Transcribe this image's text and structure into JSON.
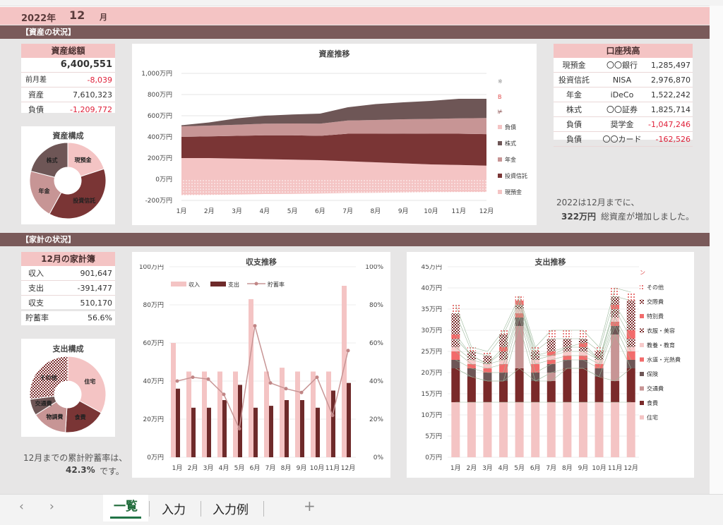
{
  "header": {
    "year": "2022年",
    "month": "12",
    "month_unit": "月"
  },
  "sections": {
    "assets": "【資産の状況】",
    "household": "【家計の状況】"
  },
  "asset_total": {
    "title": "資産総額",
    "total": "6,400,551",
    "rows": [
      {
        "label": "前月差",
        "value": "-8,039",
        "neg": true
      },
      {
        "label": "資産",
        "value": "7,610,323",
        "neg": false
      },
      {
        "label": "負債",
        "value": "-1,209,772",
        "neg": true
      }
    ]
  },
  "asset_pie": {
    "title": "資産構成",
    "labels": [
      "現預金",
      "投資信託",
      "年金",
      "株式"
    ],
    "values": [
      20,
      38,
      21,
      21
    ],
    "colors": [
      "#f4c4c4",
      "#7a3535",
      "#c79595",
      "#6e5656"
    ]
  },
  "balance": {
    "title": "口座残高",
    "rows": [
      {
        "cat": "現預金",
        "name": "〇〇銀行",
        "value": "1,285,497",
        "neg": false
      },
      {
        "cat": "投資信託",
        "name": "NISA",
        "value": "2,976,870",
        "neg": false
      },
      {
        "cat": "年金",
        "name": "iDeCo",
        "value": "1,522,242",
        "neg": false
      },
      {
        "cat": "株式",
        "name": "〇〇証券",
        "value": "1,825,714",
        "neg": false
      },
      {
        "cat": "負債",
        "name": "奨学金",
        "value": "-1,047,246",
        "neg": true
      },
      {
        "cat": "負債",
        "name": "〇〇カード",
        "value": "-162,526",
        "neg": true
      }
    ]
  },
  "asset_summary": {
    "line1": "2022は12月までに、",
    "amount": "322万円",
    "line2": "総資産が増加しました。"
  },
  "kakeibo": {
    "title": "12月の家計簿",
    "rows": [
      {
        "label": "収入",
        "value": "901,647"
      },
      {
        "label": "支出",
        "value": "-391,477"
      },
      {
        "label": "収支",
        "value": "510,170"
      }
    ],
    "rate_label": "貯蓄率",
    "rate_value": "56.6%"
  },
  "spend_pie": {
    "title": "支出構成",
    "labels": [
      "住宅",
      "食費",
      "物調費",
      "交通費",
      "その他"
    ],
    "values": [
      33,
      18,
      15,
      7,
      27
    ]
  },
  "savings_summary": {
    "line1": "12月までの累計貯蓄率は、",
    "rate": "42.3%",
    "line2": "です。"
  },
  "chart_data": [
    {
      "type": "area",
      "title": "資産推移",
      "x": [
        "1月",
        "2月",
        "3月",
        "4月",
        "5月",
        "6月",
        "7月",
        "8月",
        "9月",
        "10月",
        "11月",
        "12月"
      ],
      "y_ticks": [
        "1,000万円",
        "800万円",
        "600万円",
        "400万円",
        "200万円",
        "0万円",
        "-200万円"
      ],
      "ylim": [
        -200,
        1000
      ],
      "legend": [
        "負債",
        "株式",
        "年金",
        "投資信託",
        "現預金"
      ],
      "series": [
        {
          "name": "現預金",
          "values": [
            200,
            200,
            195,
            190,
            185,
            180,
            170,
            160,
            150,
            140,
            135,
            128
          ]
        },
        {
          "name": "投資信託",
          "values": [
            200,
            205,
            215,
            225,
            230,
            230,
            260,
            270,
            282,
            290,
            295,
            298
          ]
        },
        {
          "name": "年金",
          "values": [
            100,
            102,
            105,
            110,
            112,
            115,
            125,
            130,
            135,
            140,
            145,
            152
          ]
        },
        {
          "name": "株式",
          "values": [
            10,
            30,
            60,
            75,
            85,
            95,
            125,
            150,
            160,
            170,
            185,
            182
          ]
        },
        {
          "name": "負債",
          "values": [
            -150,
            -148,
            -145,
            -140,
            -138,
            -135,
            -130,
            -128,
            -125,
            -122,
            -121,
            -121
          ]
        }
      ]
    },
    {
      "type": "bar",
      "title": "収支推移",
      "x": [
        "1月",
        "2月",
        "3月",
        "4月",
        "5月",
        "6月",
        "7月",
        "8月",
        "9月",
        "10月",
        "11月",
        "12月"
      ],
      "y_ticks": [
        "100万円",
        "80万円",
        "60万円",
        "40万円",
        "20万円",
        "0万円"
      ],
      "y2_ticks": [
        "100%",
        "80%",
        "60%",
        "40%",
        "20%",
        "0%"
      ],
      "legend": [
        "収入",
        "支出",
        "貯蓄率"
      ],
      "series": [
        {
          "name": "収入",
          "values": [
            60,
            45,
            45,
            45,
            45,
            83,
            45,
            47,
            45,
            45,
            45,
            90
          ]
        },
        {
          "name": "支出",
          "values": [
            36,
            26,
            26,
            30,
            38,
            26,
            27,
            30,
            30,
            26,
            35,
            39
          ]
        },
        {
          "name": "貯蓄率",
          "values": [
            40,
            42,
            41,
            33,
            15,
            69,
            39,
            36,
            34,
            42,
            22,
            56
          ]
        }
      ]
    },
    {
      "type": "bar",
      "title": "支出推移",
      "x": [
        "1月",
        "2月",
        "3月",
        "4月",
        "5月",
        "6月",
        "7月",
        "8月",
        "9月",
        "10月",
        "11月",
        "12月"
      ],
      "y_ticks": [
        "45万円",
        "40万円",
        "35万円",
        "30万円",
        "25万円",
        "20万円",
        "15万円",
        "10万円",
        "5万円",
        "0万円"
      ],
      "legend": [
        "その他",
        "交際費",
        "特別費",
        "衣服・美容",
        "教養・教育",
        "水道・光熱費",
        "保険",
        "交通費",
        "食費",
        "住宅"
      ],
      "series": [
        {
          "name": "住宅",
          "values": [
            13,
            13,
            13,
            13,
            13,
            13,
            13,
            13,
            13,
            13,
            13,
            13
          ]
        },
        {
          "name": "食費",
          "values": [
            8,
            6,
            5,
            5,
            8,
            5,
            5,
            8,
            8,
            6,
            5,
            8
          ]
        },
        {
          "name": "交通費",
          "values": [
            0,
            0,
            0,
            0,
            10,
            0,
            2,
            0,
            0,
            0,
            11,
            0
          ]
        },
        {
          "name": "保険",
          "values": [
            2,
            2,
            2,
            2,
            2,
            2,
            2,
            2,
            2,
            2,
            2,
            2
          ]
        },
        {
          "name": "水道・光熱費",
          "values": [
            2,
            1,
            1,
            2,
            1,
            2,
            1,
            1,
            1,
            1,
            1,
            2
          ]
        },
        {
          "name": "教養・教育",
          "values": [
            1,
            1,
            1,
            1,
            1,
            1,
            1,
            1,
            1,
            1,
            1,
            1
          ]
        },
        {
          "name": "衣服・美容",
          "values": [
            2,
            1,
            0,
            2,
            1,
            1,
            0,
            1,
            1,
            0,
            2,
            2
          ]
        },
        {
          "name": "特別費",
          "values": [
            1,
            0,
            0,
            1,
            1,
            0,
            1,
            0,
            1,
            0,
            1,
            2
          ]
        },
        {
          "name": "交際費",
          "values": [
            5,
            1,
            2,
            3,
            0,
            1,
            3,
            2,
            1,
            2,
            2,
            7
          ]
        },
        {
          "name": "その他",
          "values": [
            2,
            1,
            1,
            1,
            1,
            1,
            2,
            2,
            2,
            1,
            2,
            2
          ]
        }
      ]
    }
  ],
  "tabs": {
    "prev": "‹",
    "next": "›",
    "sheets": [
      "一覧",
      "入力",
      "入力例"
    ],
    "add": "+"
  }
}
